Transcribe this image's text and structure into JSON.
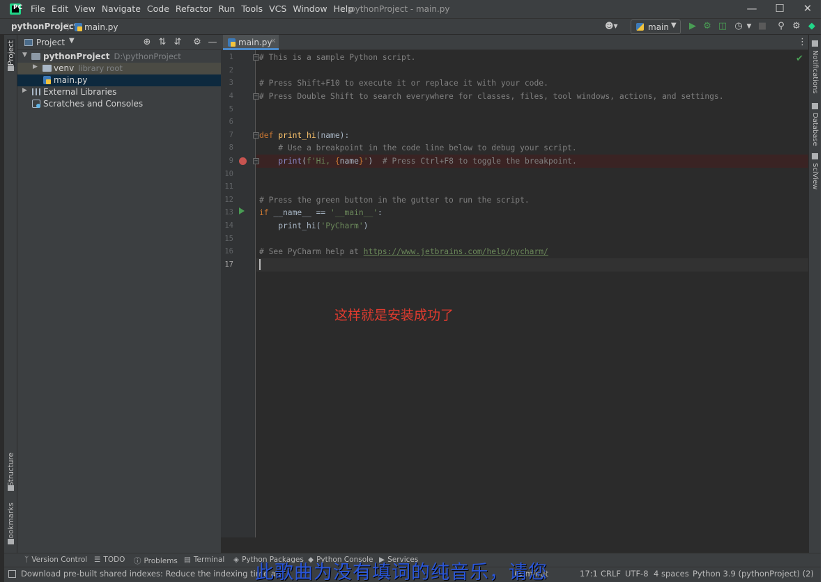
{
  "app": {
    "menu": [
      "File",
      "Edit",
      "View",
      "Navigate",
      "Code",
      "Refactor",
      "Run",
      "Tools",
      "VCS",
      "Window",
      "Help"
    ],
    "window_title": "pythonProject - main.py",
    "controls": {
      "minimize": "—",
      "maximize": "☐",
      "close": "✕"
    }
  },
  "navbar": {
    "project": "pythonProject",
    "separator": "〉",
    "file": "main.py",
    "run_config": "main"
  },
  "left_tabs": {
    "project": "Project",
    "structure": "Structure",
    "bookmarks": "Bookmarks"
  },
  "project_panel": {
    "title": "Project",
    "tree": {
      "root_name": "pythonProject",
      "root_path": "D:\\pythonProject",
      "venv_name": "venv",
      "venv_note": "library root",
      "main_file": "main.py",
      "external": "External Libraries",
      "scratches": "Scratches and Consoles"
    }
  },
  "editor": {
    "tab": "main.py",
    "line_numbers": [
      "1",
      "2",
      "3",
      "4",
      "5",
      "6",
      "7",
      "8",
      "9",
      "10",
      "11",
      "12",
      "13",
      "14",
      "15",
      "16",
      "17"
    ],
    "current_line": "17",
    "code": {
      "l1": "# This is a sample Python script.",
      "l3": "# Press Shift+F10 to execute it or replace it with your code.",
      "l4": "# Press Double Shift to search everywhere for classes, files, tool windows, actions, and settings.",
      "l7_kw": "def ",
      "l7_fn": "print_hi",
      "l7_rest": "(name):",
      "l8": "# Use a breakpoint in the code line below to debug your script.",
      "l9_bi": "print",
      "l9_open": "(",
      "l9_str1": "f'Hi, ",
      "l9_br1": "{",
      "l9_var": "name",
      "l9_br2": "}",
      "l9_str2": "'",
      "l9_close": ")",
      "l9_cmt": "  # Press Ctrl+F8 to toggle the breakpoint.",
      "l12": "# Press the green button in the gutter to run the script.",
      "l13_kw": "if ",
      "l13_mid": "__name__ == ",
      "l13_str": "'__main__'",
      "l13_end": ":",
      "l14_fn": "print_hi",
      "l14_open": "(",
      "l14_str": "'PyCharm'",
      "l14_close": ")",
      "l16_cmt": "# See PyCharm help at ",
      "l16_link": "https://www.jetbrains.com/help/pycharm/"
    },
    "annotation": "这样就是安装成功了"
  },
  "right_tabs": {
    "notifications": "Notifications",
    "database": "Database",
    "sciview": "SciView"
  },
  "bottom_tabs": [
    "Version Control",
    "TODO",
    "Problems",
    "Terminal",
    "Python Packages",
    "Python Console",
    "Services"
  ],
  "status": {
    "message": "Download pre-built shared indexes: Reduce the indexing time an",
    "time_fragment": "(3 minut",
    "position": "17:1",
    "line_sep": "CRLF",
    "encoding": "UTF-8",
    "indent": "4 spaces",
    "interpreter": "Python 3.9 (pythonProject) (2)"
  },
  "overlay_subtitle": "此歌曲为没有填词的纯音乐，请您",
  "colors": {
    "accent": "#4a88c7",
    "breakpoint": "#c75450",
    "run": "#499c54",
    "annotation": "#e03b2f",
    "subtitle": "#2a56d8"
  }
}
